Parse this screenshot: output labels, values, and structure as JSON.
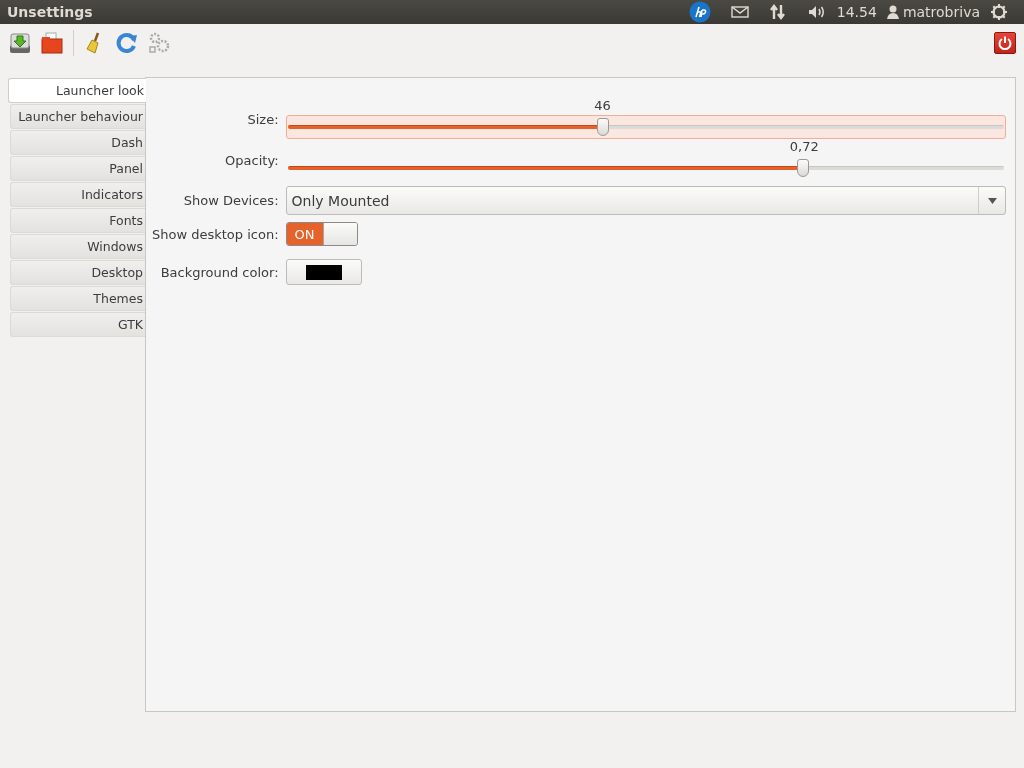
{
  "top_panel": {
    "title": "Unsettings",
    "clock": "14.54",
    "user": "matrobriva"
  },
  "tabs": [
    {
      "label": "Launcher look",
      "selected": true
    },
    {
      "label": "Launcher behaviour",
      "selected": false
    },
    {
      "label": "Dash",
      "selected": false
    },
    {
      "label": "Panel",
      "selected": false
    },
    {
      "label": "Indicators",
      "selected": false
    },
    {
      "label": "Fonts",
      "selected": false
    },
    {
      "label": "Windows",
      "selected": false
    },
    {
      "label": "Desktop",
      "selected": false
    },
    {
      "label": "Themes",
      "selected": false
    },
    {
      "label": "GTK",
      "selected": false
    }
  ],
  "settings": [
    {
      "kind": "slider",
      "label": "Size:",
      "reading": "46",
      "level": 0.44,
      "focused": true
    },
    {
      "kind": "slider",
      "label": "Opacity:",
      "reading": "0,72",
      "level": 0.72,
      "focused": false
    },
    {
      "kind": "combo",
      "label": "Show Devices:",
      "value": "Only Mounted"
    },
    {
      "kind": "switch",
      "label": "Show desktop icon:",
      "on": true,
      "on_text": "ON"
    },
    {
      "kind": "color",
      "label": "Background color:",
      "color": "#000000"
    }
  ]
}
